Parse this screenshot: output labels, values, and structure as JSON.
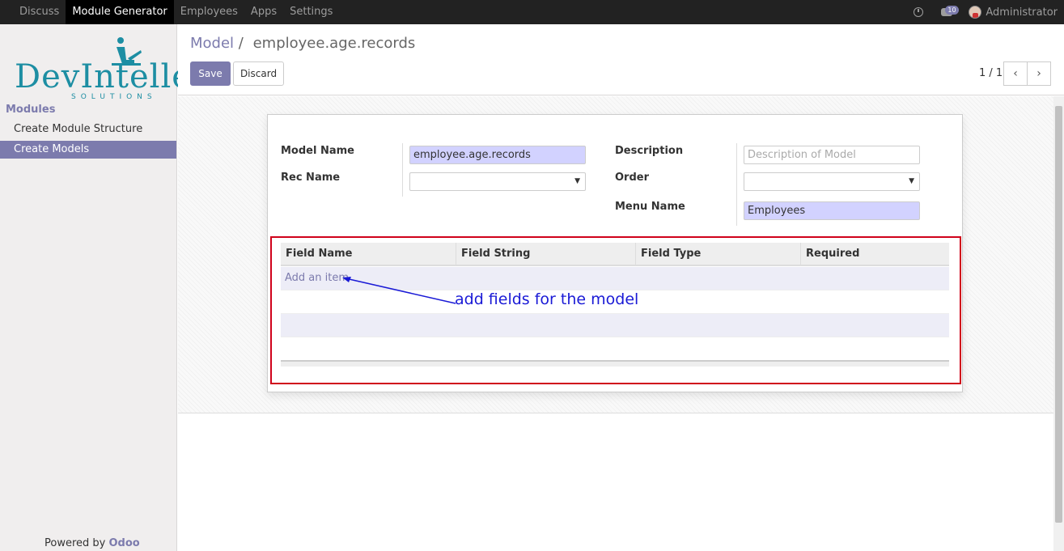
{
  "topbar": {
    "menu": [
      "Discuss",
      "Module Generator",
      "Employees",
      "Apps",
      "Settings"
    ],
    "chat_count": "10",
    "user": "Administrator"
  },
  "sidebar": {
    "logo_text": "DevIntelle",
    "logo_subtitle": "SOLUTIONS",
    "section": "Modules",
    "items": [
      "Create Module Structure",
      "Create Models"
    ],
    "powered_prefix": "Powered by",
    "powered_brand": "Odoo"
  },
  "control_panel": {
    "breadcrumb_parent": "Model",
    "breadcrumb_sep": "/",
    "breadcrumb_current": "employee.age.records",
    "save_label": "Save",
    "discard_label": "Discard",
    "pager": "1 / 1"
  },
  "form": {
    "model_name_label": "Model Name",
    "model_name_value": "employee.age.records",
    "rec_name_label": "Rec Name",
    "rec_name_value": "",
    "description_label": "Description",
    "description_placeholder": "Description of Model",
    "order_label": "Order",
    "order_value": "",
    "menu_name_label": "Menu Name",
    "menu_name_value": "Employees"
  },
  "fields_table": {
    "columns": [
      "Field Name",
      "Field String",
      "Field Type",
      "Required"
    ],
    "add_item": "Add an item"
  },
  "annotation": "add fields for the model",
  "colors": {
    "accent": "#7c7bad",
    "topbar": "#222222",
    "highlight_box": "#d0021b",
    "annotation": "#1a1ad6"
  }
}
